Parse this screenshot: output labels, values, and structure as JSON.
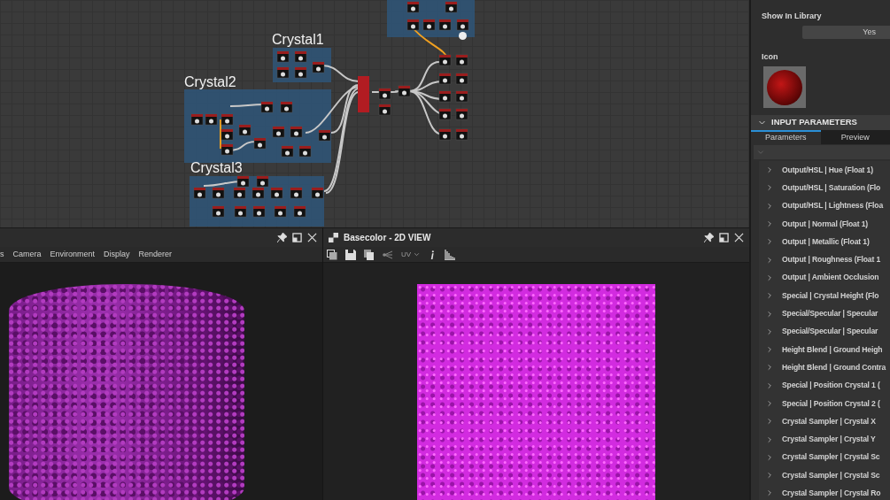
{
  "graph": {
    "frames": [
      {
        "title": "Crystal1"
      },
      {
        "title": "Crystal2"
      },
      {
        "title": "Crystal3"
      }
    ]
  },
  "view_3d": {
    "menu": [
      "s",
      "Camera",
      "Environment",
      "Display",
      "Renderer"
    ]
  },
  "view_2d": {
    "title": "Basecolor - 2D VIEW",
    "uv_dropdown": {
      "label": "UV",
      "disabled": true
    }
  },
  "properties": {
    "show_in_library": {
      "label": "Show In Library",
      "value": "Yes"
    },
    "icon": {
      "label": "Icon"
    },
    "input_parameters": {
      "title": "INPUT PARAMETERS",
      "expanded": true,
      "tabs": [
        {
          "label": "Parameters",
          "selected": true
        },
        {
          "label": "Preview",
          "selected": false
        }
      ],
      "parameters": [
        {
          "label": "Output/HSL | Hue (Float 1)",
          "expanded": false
        },
        {
          "label": "Output/HSL | Saturation (Flo",
          "expanded": false
        },
        {
          "label": "Output/HSL | Lightness (Floa",
          "expanded": false
        },
        {
          "label": "Output | Normal (Float 1)",
          "expanded": false
        },
        {
          "label": "Output | Metallic (Float 1)",
          "expanded": false
        },
        {
          "label": "Output | Roughness (Float 1",
          "expanded": false
        },
        {
          "label": "Output | Ambient Occlusion",
          "expanded": false
        },
        {
          "label": "Special | Crystal Height (Flo",
          "expanded": false
        },
        {
          "label": "Special/Specular | Specular",
          "expanded": false
        },
        {
          "label": "Special/Specular | Specular",
          "expanded": false
        },
        {
          "label": "Height Blend | Ground Heigh",
          "expanded": false
        },
        {
          "label": "Height Blend | Ground Contra",
          "expanded": false
        },
        {
          "label": "Special | Position Crystal 1 (",
          "expanded": false
        },
        {
          "label": "Special | Position Crystal 2 (",
          "expanded": false
        },
        {
          "label": "Crystal Sampler | Crystal X",
          "expanded": false
        },
        {
          "label": "Crystal Sampler | Crystal Y",
          "expanded": false
        },
        {
          "label": "Crystal Sampler | Crystal Sc",
          "expanded": false
        },
        {
          "label": "Crystal Sampler | Crystal Sc",
          "expanded": false
        },
        {
          "label": "Crystal Sampler | Crystal Ro",
          "expanded": false
        }
      ]
    }
  }
}
